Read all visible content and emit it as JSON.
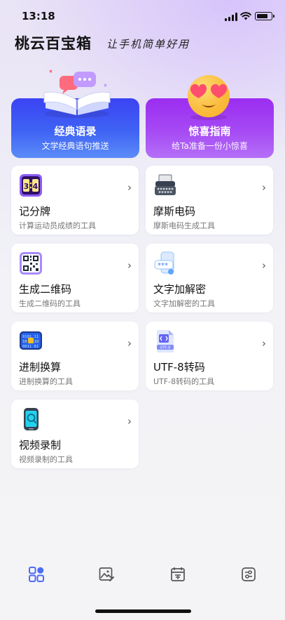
{
  "status": {
    "time": "13:18"
  },
  "header": {
    "title": "桃云百宝箱",
    "slogan": "让手机简单好用"
  },
  "features": [
    {
      "title": "经典语录",
      "subtitle": "文学经典语句推送"
    },
    {
      "title": "惊喜指南",
      "subtitle": "给Ta准备一份小惊喜"
    }
  ],
  "tools": [
    {
      "name": "记分牌",
      "desc": "计算运动员成绩的工具",
      "icon": "scoreboard-icon"
    },
    {
      "name": "摩斯电码",
      "desc": "摩斯电码生成工具",
      "icon": "typewriter-icon"
    },
    {
      "name": "生成二维码",
      "desc": "生成二维码的工具",
      "icon": "qr-code-icon"
    },
    {
      "name": "文字加解密",
      "desc": "文字加解密的工具",
      "icon": "password-phone-icon"
    },
    {
      "name": "进制换算",
      "desc": "进制换算的工具",
      "icon": "binary-chip-icon"
    },
    {
      "name": "UTF-8转码",
      "desc": "UTF-8转码的工具",
      "icon": "code-file-icon"
    },
    {
      "name": "视频录制",
      "desc": "视频录制的工具",
      "icon": "phone-record-icon"
    }
  ],
  "chevron": "›",
  "tabs": [
    {
      "icon": "grid-icon",
      "active": true
    },
    {
      "icon": "image-edit-icon",
      "active": false
    },
    {
      "icon": "calendar-icon",
      "active": false
    },
    {
      "icon": "settings-toggle-icon",
      "active": false
    }
  ],
  "colors": {
    "accent": "#3f63f4",
    "purple": "#a64af4",
    "tab_active": "#4d6cf6",
    "tab_inactive": "#555555"
  }
}
